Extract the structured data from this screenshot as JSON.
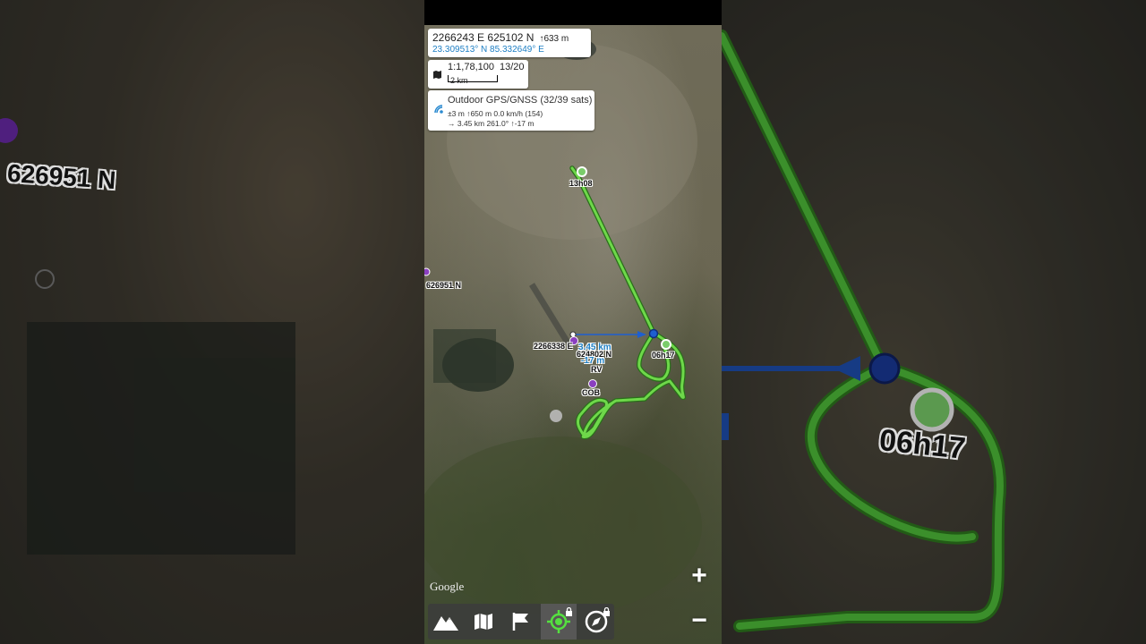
{
  "coords": {
    "grid": "2266243 E  625102 N",
    "altitude": "↑633 m",
    "latlon": "23.309513° N 85.332649° E"
  },
  "scale": {
    "ratio": "1:1,78,100",
    "zoom": "13/20",
    "bar_label": "2 km"
  },
  "gps": {
    "title": "Outdoor GPS/GNSS (32/39 sats)",
    "line2": "±3 m   ↑650 m   0.0 km/h   (154)",
    "line3": "→ 3.45 km   261.0°   ↑-17 m"
  },
  "map_labels": {
    "start_time": "13h08",
    "end_time": "06h17",
    "waypoint_north": "626951 N",
    "cursor_east": "2266338 E",
    "cursor_north": "624802 N",
    "distance": "3.45 km",
    "elev_diff": "-17 m",
    "poi_rv": "RV",
    "poi_cob": "COB"
  },
  "attribution": "Google",
  "zoom_controls": {
    "in": "+",
    "out": "−"
  },
  "toolbar": {
    "buttons": [
      "terrain-icon",
      "map-icon",
      "flag-icon",
      "gps-locate-icon",
      "compass-icon"
    ]
  },
  "side_labels": {
    "left": "626951 N",
    "right": "06h17"
  },
  "colors": {
    "track": "#6ed84a",
    "track_outline": "#2a6f1a",
    "measure_line": "#1e5fd0",
    "waypoint": "#8a3fc0",
    "accent_blue": "#1e7fc4"
  }
}
